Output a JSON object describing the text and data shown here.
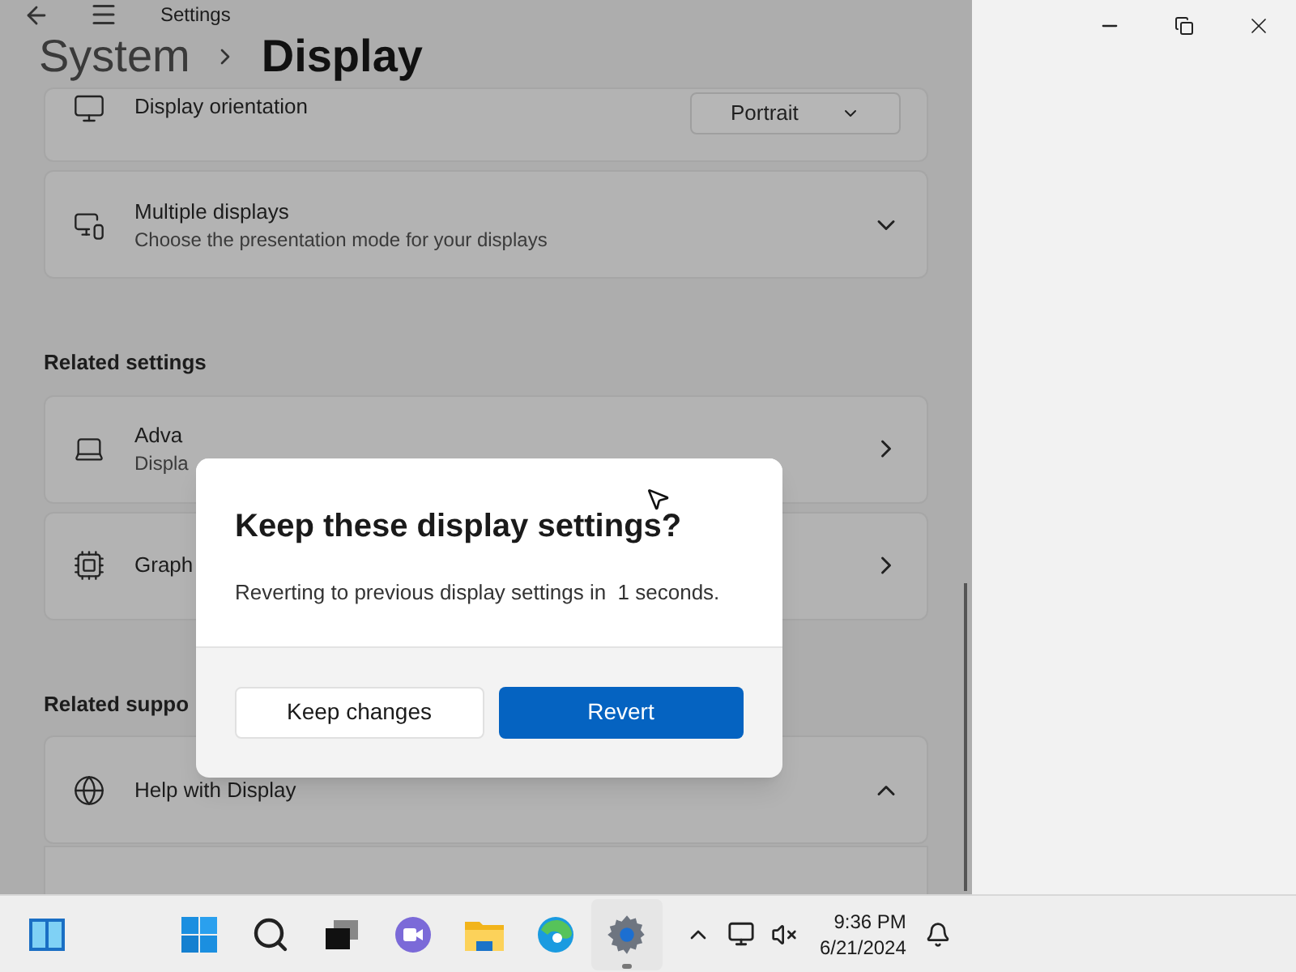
{
  "window": {
    "title": "Settings"
  },
  "breadcrumb": {
    "parent": "System",
    "current": "Display"
  },
  "content": [
    {
      "kind": "dropdown",
      "title": "Display orientation",
      "value": "Portrait"
    },
    {
      "kind": "expander",
      "title": "Multiple displays",
      "subtitle": "Choose the presentation mode for your displays",
      "expanded": false
    },
    {
      "kind": "heading",
      "text": "Related settings"
    },
    {
      "kind": "link",
      "title": "Adva",
      "subtitle": "Displa"
    },
    {
      "kind": "link",
      "title": "Graph"
    },
    {
      "kind": "heading",
      "text": "Related suppo"
    },
    {
      "kind": "expander",
      "title": "Help with Display",
      "expanded": true
    }
  ],
  "dialog": {
    "title": "Keep these display settings?",
    "message": "Reverting to previous display settings in  1 seconds.",
    "buttons": [
      {
        "label": "Keep changes",
        "primary": false
      },
      {
        "label": "Revert",
        "primary": true
      }
    ]
  },
  "taskbar": {
    "apps": [
      {
        "running": false
      },
      {
        "running": false
      },
      {
        "running": false
      },
      {
        "running": false
      },
      {
        "running": false
      },
      {
        "running": false
      },
      {
        "running": true
      }
    ],
    "time": "9:36 PM",
    "date": "6/21/2024"
  }
}
